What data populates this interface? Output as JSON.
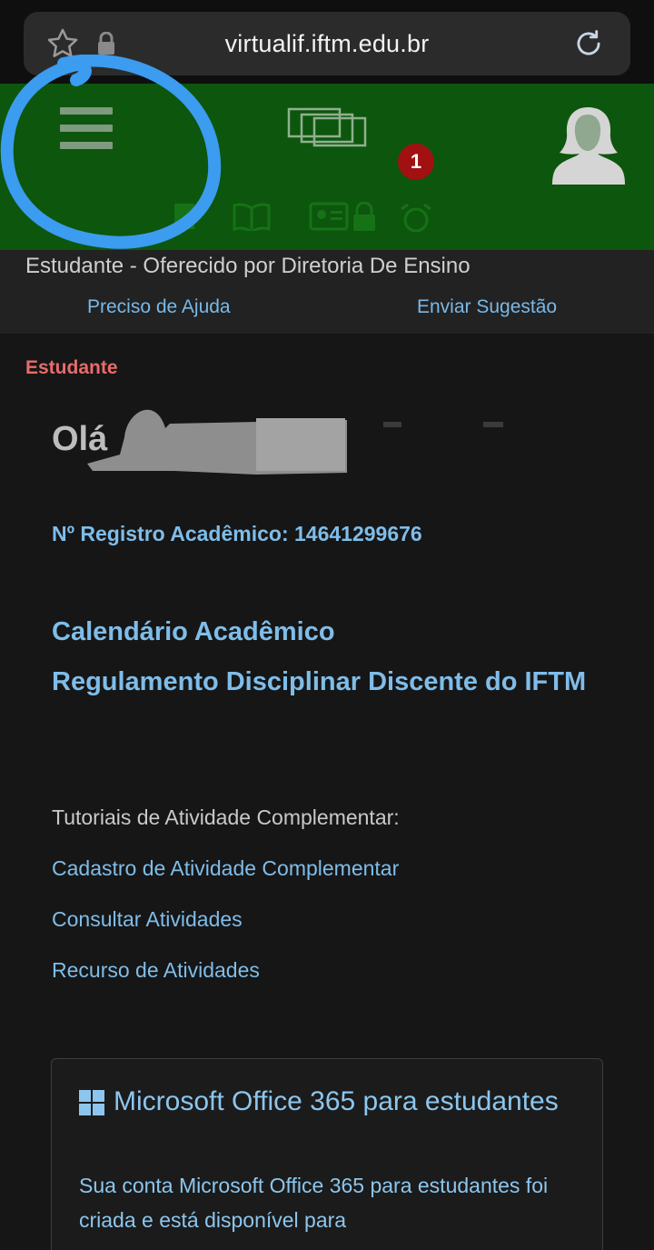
{
  "browser": {
    "url": "virtualif.iftm.edu.br"
  },
  "header": {
    "notification_count": "1"
  },
  "subheader": {
    "offer_text": "Estudante - Oferecido por Diretoria De Ensino",
    "help_link": "Preciso de Ajuda",
    "suggest_link": "Enviar Sugestão"
  },
  "main": {
    "role": "Estudante",
    "greeting": "Olá",
    "registro": "Nº Registro Acadêmico: 14641299676",
    "calendar_link": "Calendário Acadêmico",
    "regulation_link": "Regulamento Disciplinar Discente do IFTM",
    "tutorials_title": "Tutoriais de Atividade Complementar:",
    "tutorials": [
      "Cadastro de Atividade Complementar",
      "Consultar Atividades",
      "Recurso de Atividades"
    ]
  },
  "office_card": {
    "title": "Microsoft Office 365 para estudantes",
    "description": "Sua conta Microsoft Office 365 para estudantes foi criada e está disponível para"
  },
  "colors": {
    "header_green": "#0d560d",
    "link_blue": "#7fbde9",
    "role_red": "#e96b6b",
    "annotation_blue": "#3b9cf0"
  }
}
